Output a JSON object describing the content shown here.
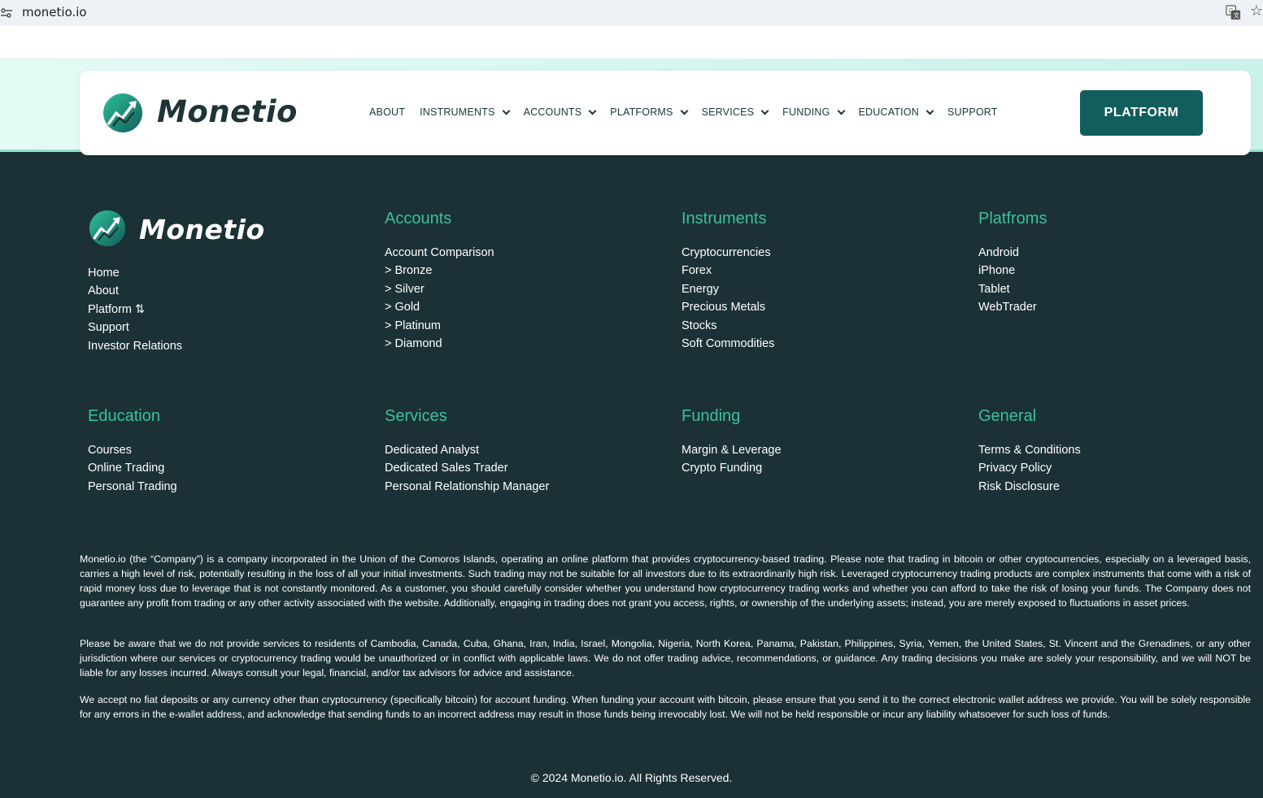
{
  "browser": {
    "url": "monetio.io"
  },
  "brand": {
    "name": "Monetio",
    "accent": "#125e5c",
    "heading_color": "#3cc19b",
    "footer_bg": "#1b3135"
  },
  "nav": {
    "items": [
      {
        "label": "ABOUT",
        "has_dropdown": false
      },
      {
        "label": "INSTRUMENTS",
        "has_dropdown": true
      },
      {
        "label": "ACCOUNTS",
        "has_dropdown": true
      },
      {
        "label": "PLATFORMS",
        "has_dropdown": true
      },
      {
        "label": "SERVICES",
        "has_dropdown": true
      },
      {
        "label": "FUNDING",
        "has_dropdown": true
      },
      {
        "label": "EDUCATION",
        "has_dropdown": true
      },
      {
        "label": "SUPPORT",
        "has_dropdown": false
      }
    ],
    "cta_label": "PLATFORM"
  },
  "footer": {
    "main_links": [
      "Home",
      "About",
      "Platform ⇅",
      "Support",
      "Investor Relations"
    ],
    "accounts": {
      "title": "Accounts",
      "links": [
        "Account Comparison",
        "> Bronze",
        "> Silver",
        "> Gold",
        "> Platinum",
        "> Diamond"
      ]
    },
    "instruments": {
      "title": "Instruments",
      "links": [
        "Cryptocurrencies",
        "Forex",
        "Energy",
        "Precious Metals",
        "Stocks",
        "Soft Commodities"
      ]
    },
    "platforms": {
      "title": "Platfroms",
      "links": [
        "Android",
        "iPhone",
        "Tablet",
        "WebTrader"
      ]
    },
    "education": {
      "title": "Education",
      "links": [
        "Courses",
        "Online Trading",
        "Personal Trading"
      ]
    },
    "services": {
      "title": "Services",
      "links": [
        "Dedicated Analyst",
        "Dedicated Sales Trader",
        "Personal Relationship Manager"
      ]
    },
    "funding": {
      "title": "Funding",
      "links": [
        "Margin & Leverage",
        "Crypto Funding"
      ]
    },
    "general": {
      "title": "General",
      "links": [
        "Terms & Conditions",
        "Privacy Policy",
        "Risk Disclosure"
      ]
    },
    "disclaimer": [
      "Monetio.io (the “Company”) is a company incorporated in the Union of the Comoros Islands, operating an online platform that provides cryptocurrency-based trading. Please note that trading in bitcoin or other cryptocurrencies, especially on a leveraged basis, carries a high level of risk, potentially resulting in the loss of all your initial investments. Such trading may not be suitable for all investors due to its extraordinarily high risk. Leveraged cryptocurrency trading products are complex instruments that come with a risk of rapid money loss due to leverage that is not constantly monitored. As a customer, you should carefully consider whether you understand how cryptocurrency trading works and whether you can afford to take the risk of losing your funds. The Company does not guarantee any profit from trading or any other activity associated with the website. Additionally, engaging in trading does not grant you access, rights, or ownership of the underlying assets; instead, you are merely exposed to fluctuations in asset prices.",
      "Please be aware that we do not provide services to residents of Cambodia, Canada, Cuba, Ghana, Iran, India, Israel, Mongolia, Nigeria, North Korea, Panama, Pakistan, Philippines, Syria, Yemen, the United States, St. Vincent and the Grenadines, or any other jurisdiction where our services or cryptocurrency trading would be unauthorized or in conflict with applicable laws. We do not offer trading advice, recommendations, or guidance. Any trading decisions you make are solely your responsibility, and we will NOT be liable for any losses incurred. Always consult your legal, financial, and/or tax advisors for advice and assistance.",
      "We accept no fiat deposits or any currency other than cryptocurrency (specifically bitcoin) for account funding. When funding your account with bitcoin, please ensure that you send it to the correct electronic wallet address we provide. You will be solely responsible for any errors in the e-wallet address, and acknowledge that sending funds to an incorrect address may result in those funds being irrevocably lost. We will not be held responsible or incur any liability whatsoever for such loss of funds."
    ],
    "copyright": "© 2024 Monetio.io. All Rights Reserved."
  }
}
